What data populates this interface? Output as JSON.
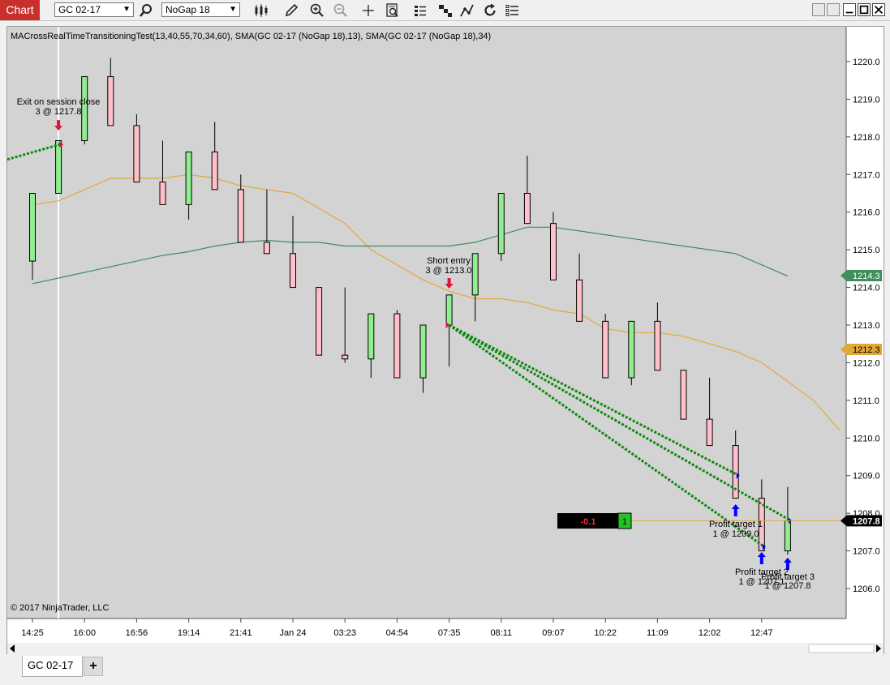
{
  "toolbar": {
    "chart_label": "Chart",
    "instrument": "GC 02-17",
    "bar_type": "NoGap 18"
  },
  "chart": {
    "indicator_label": "MACrossRealTimeTransitioningTest(13,40,55,70,34,60), SMA(GC 02-17 (NoGap 18),13), SMA(GC 02-17 (NoGap 18),34)",
    "copyright": "© 2017 NinjaTrader, LLC",
    "colors": {
      "background": "#d3d3d3",
      "up_candle": "#90ee90",
      "down_candle": "#ffc0cb",
      "sma13": "#e2a93a",
      "sma34": "#3e8e5e",
      "trade_line": "#0a8a0a",
      "current_price": "#000000"
    },
    "time_labels": [
      "14:25",
      "16:00",
      "16:56",
      "19:14",
      "21:41",
      "Jan 24",
      "03:23",
      "04:54",
      "07:35",
      "08:11",
      "09:07",
      "10:22",
      "11:09",
      "12:02",
      "12:47"
    ],
    "price_labels": [
      "1220.0",
      "1219.0",
      "1218.0",
      "1217.0",
      "1216.0",
      "1215.0",
      "1214.0",
      "1213.0",
      "1212.0",
      "1211.0",
      "1210.0",
      "1209.0",
      "1208.0",
      "1207.0",
      "1206.0"
    ],
    "price_tags": {
      "sma34": "1214.3",
      "sma13": "1212.3",
      "last": "1207.8"
    },
    "pnl_box": {
      "pnl": "-0.1",
      "position": "1"
    },
    "annotations": [
      {
        "name": "exit-session-close",
        "line1": "Exit on session close",
        "line2": "3 @ 1217.8"
      },
      {
        "name": "short-entry",
        "line1": "Short entry",
        "line2": "3 @ 1213.0"
      },
      {
        "name": "profit-target-1",
        "line1": "Profit target 1",
        "line2": "1 @ 1209.0"
      },
      {
        "name": "profit-target-2",
        "line1": "Profit target 2",
        "line2": "1 @ 1207.1"
      },
      {
        "name": "profit-target-3",
        "line1": "Profit target 3",
        "line2": "1 @ 1207.8"
      }
    ]
  },
  "chart_data": {
    "type": "candlestick",
    "y_range": [
      1205.2,
      1221.2
    ],
    "candles": [
      {
        "o": 1214.7,
        "h": 1216.5,
        "l": 1214.2,
        "c": 1216.5
      },
      {
        "o": 1216.5,
        "h": 1217.9,
        "l": 1216.5,
        "c": 1217.9
      },
      {
        "o": 1217.9,
        "h": 1219.6,
        "l": 1217.8,
        "c": 1219.6
      },
      {
        "o": 1219.6,
        "h": 1220.1,
        "l": 1218.3,
        "c": 1218.3
      },
      {
        "o": 1218.3,
        "h": 1218.6,
        "l": 1216.8,
        "c": 1216.8
      },
      {
        "o": 1216.8,
        "h": 1217.9,
        "l": 1216.2,
        "c": 1216.2
      },
      {
        "o": 1216.2,
        "h": 1217.6,
        "l": 1215.8,
        "c": 1217.6
      },
      {
        "o": 1217.6,
        "h": 1218.4,
        "l": 1216.6,
        "c": 1216.6
      },
      {
        "o": 1216.6,
        "h": 1217.0,
        "l": 1215.2,
        "c": 1215.2
      },
      {
        "o": 1215.2,
        "h": 1216.6,
        "l": 1214.9,
        "c": 1214.9
      },
      {
        "o": 1214.9,
        "h": 1215.9,
        "l": 1214.0,
        "c": 1214.0
      },
      {
        "o": 1214.0,
        "h": 1214.0,
        "l": 1212.2,
        "c": 1212.2
      },
      {
        "o": 1212.2,
        "h": 1214.0,
        "l": 1212.0,
        "c": 1212.1
      },
      {
        "o": 1212.1,
        "h": 1213.3,
        "l": 1211.6,
        "c": 1213.3
      },
      {
        "o": 1213.3,
        "h": 1213.4,
        "l": 1211.6,
        "c": 1211.6
      },
      {
        "o": 1211.6,
        "h": 1213.0,
        "l": 1211.2,
        "c": 1213.0
      },
      {
        "o": 1213.0,
        "h": 1213.8,
        "l": 1211.9,
        "c": 1213.8
      },
      {
        "o": 1213.8,
        "h": 1214.9,
        "l": 1213.1,
        "c": 1214.9
      },
      {
        "o": 1214.9,
        "h": 1216.5,
        "l": 1214.7,
        "c": 1216.5
      },
      {
        "o": 1216.5,
        "h": 1217.5,
        "l": 1215.7,
        "c": 1215.7
      },
      {
        "o": 1215.7,
        "h": 1216.0,
        "l": 1214.2,
        "c": 1214.2
      },
      {
        "o": 1214.2,
        "h": 1214.9,
        "l": 1213.1,
        "c": 1213.1
      },
      {
        "o": 1213.1,
        "h": 1213.3,
        "l": 1211.6,
        "c": 1211.6
      },
      {
        "o": 1211.6,
        "h": 1213.1,
        "l": 1211.4,
        "c": 1213.1
      },
      {
        "o": 1213.1,
        "h": 1213.6,
        "l": 1211.8,
        "c": 1211.8
      },
      {
        "o": 1211.8,
        "h": 1211.8,
        "l": 1210.5,
        "c": 1210.5
      },
      {
        "o": 1210.5,
        "h": 1211.6,
        "l": 1209.8,
        "c": 1209.8
      },
      {
        "o": 1209.8,
        "h": 1210.2,
        "l": 1208.4,
        "c": 1208.4
      },
      {
        "o": 1208.4,
        "h": 1208.9,
        "l": 1207.0,
        "c": 1207.0
      },
      {
        "o": 1207.0,
        "h": 1208.7,
        "l": 1206.9,
        "c": 1207.8
      }
    ],
    "sma13": [
      1216.2,
      1216.3,
      1216.6,
      1216.9,
      1216.9,
      1216.9,
      1217.0,
      1216.9,
      1216.7,
      1216.6,
      1216.5,
      1216.1,
      1215.7,
      1215.0,
      1214.6,
      1214.2,
      1213.9,
      1213.7,
      1213.7,
      1213.6,
      1213.4,
      1213.3,
      1212.9,
      1212.8,
      1212.8,
      1212.7,
      1212.5,
      1212.3,
      1212.0,
      1211.5,
      1211.0,
      1210.2
    ],
    "sma34": [
      1214.1,
      1214.25,
      1214.4,
      1214.55,
      1214.7,
      1214.85,
      1214.95,
      1215.1,
      1215.2,
      1215.25,
      1215.2,
      1215.2,
      1215.1,
      1215.1,
      1215.1,
      1215.1,
      1215.1,
      1215.2,
      1215.4,
      1215.6,
      1215.6,
      1215.5,
      1215.4,
      1215.3,
      1215.2,
      1215.1,
      1215.0,
      1214.9,
      1214.6,
      1214.3
    ],
    "current_price": 1207.8,
    "trades": [
      {
        "kind": "exit",
        "bar": 1,
        "price": 1217.8
      },
      {
        "kind": "entry",
        "bar": 16,
        "price": 1213.0
      },
      {
        "kind": "target",
        "bar": 28,
        "price": 1209.0
      },
      {
        "kind": "target",
        "bar": 29,
        "price": 1207.1
      },
      {
        "kind": "target",
        "bar": 30,
        "price": 1207.8
      }
    ]
  }
}
